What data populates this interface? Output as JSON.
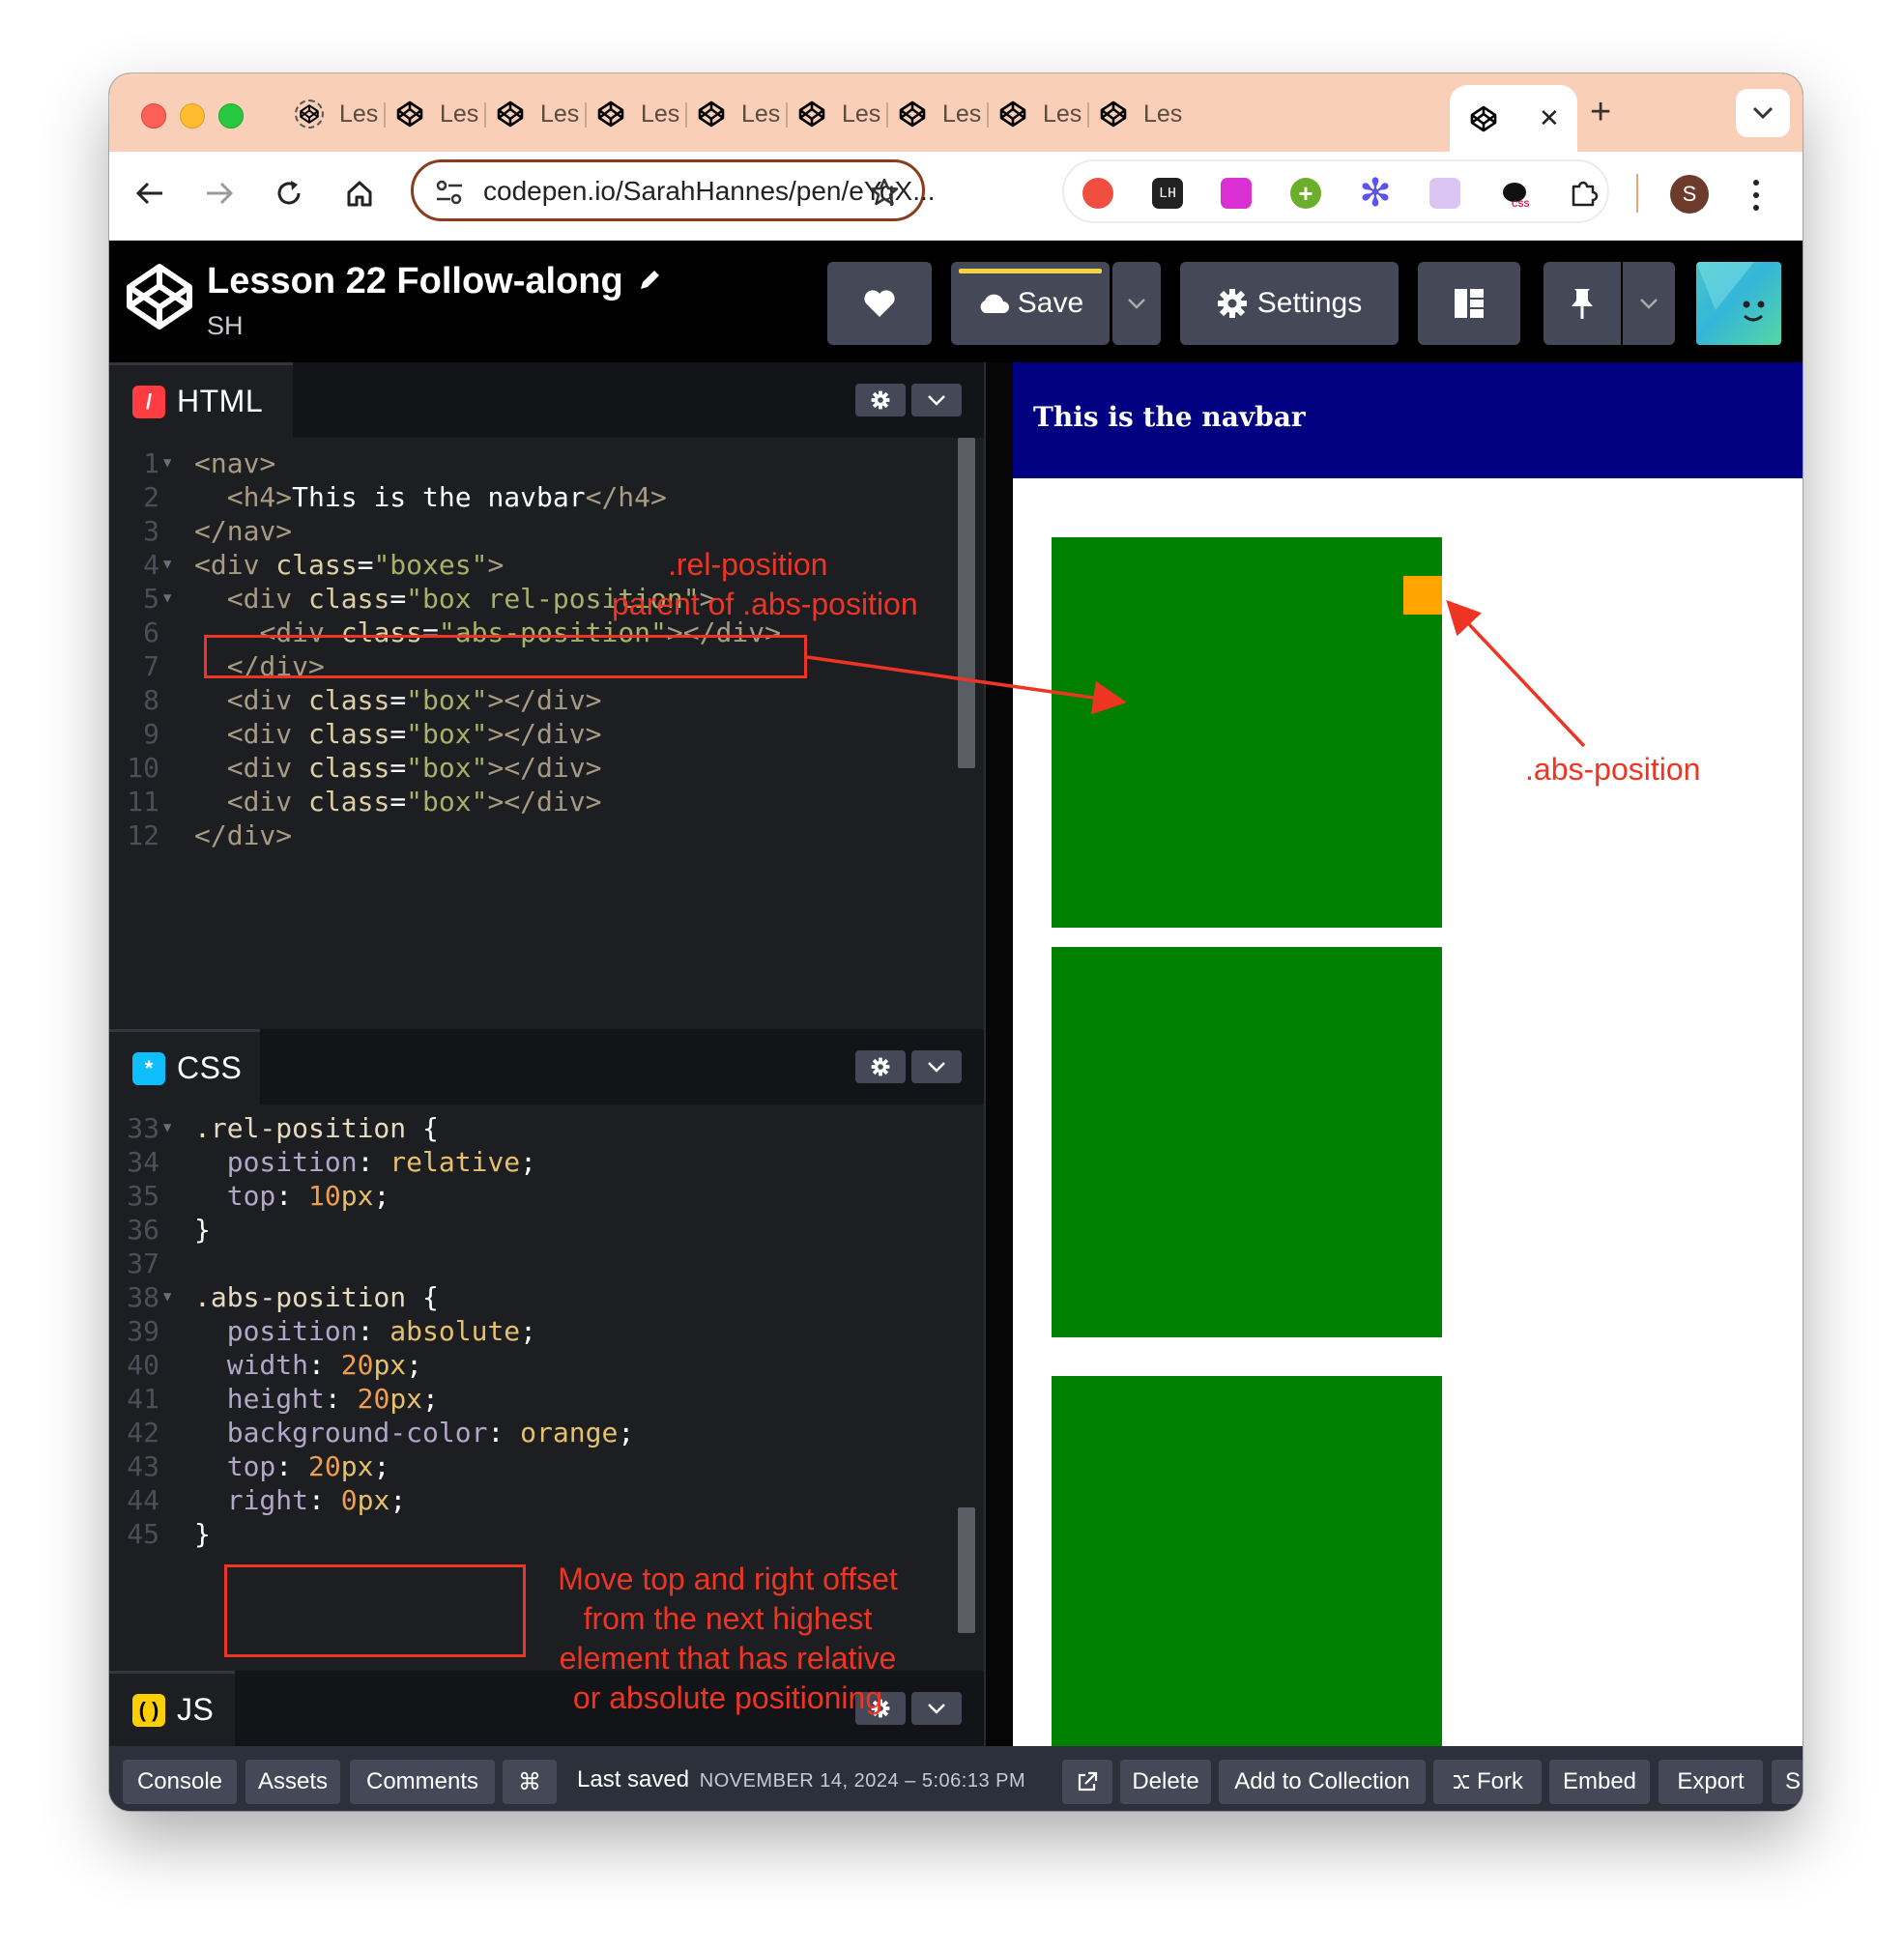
{
  "browser": {
    "tabs": [
      {
        "label": "Les"
      },
      {
        "label": "Les"
      },
      {
        "label": "Les"
      },
      {
        "label": "Les"
      },
      {
        "label": "Les"
      },
      {
        "label": "Les"
      },
      {
        "label": "Les"
      },
      {
        "label": "Les"
      },
      {
        "label": "Les"
      }
    ],
    "active_tab_close": "✕",
    "new_tab": "+",
    "url": "codepen.io/SarahHannes/pen/eYqX...",
    "profile_initial": "S"
  },
  "codepen": {
    "pen_title": "Lesson 22 Follow-along",
    "author": "SH",
    "save_label": "Save",
    "settings_label": "Settings"
  },
  "editor": {
    "html_panel_label": "HTML",
    "css_panel_label": "CSS",
    "js_panel_label": "JS",
    "html_lines": [
      {
        "n": "1",
        "code": "<nav>"
      },
      {
        "n": "2",
        "code": "  <h4>This is the navbar</h4>"
      },
      {
        "n": "3",
        "code": "</nav>"
      },
      {
        "n": "4",
        "code": "<div class=\"boxes\">"
      },
      {
        "n": "5",
        "code": "  <div class=\"box rel-position\">"
      },
      {
        "n": "6",
        "code": "    <div class=\"abs-position\"></div>"
      },
      {
        "n": "7",
        "code": "  </div>"
      },
      {
        "n": "8",
        "code": "  <div class=\"box\"></div>"
      },
      {
        "n": "9",
        "code": "  <div class=\"box\"></div>"
      },
      {
        "n": "10",
        "code": "  <div class=\"box\"></div>"
      },
      {
        "n": "11",
        "code": "  <div class=\"box\"></div>"
      },
      {
        "n": "12",
        "code": "</div>"
      }
    ],
    "css_lines": [
      {
        "n": "33",
        "code": ".rel-position {"
      },
      {
        "n": "34",
        "code": "  position: relative;"
      },
      {
        "n": "35",
        "code": "  top: 10px;"
      },
      {
        "n": "36",
        "code": "}"
      },
      {
        "n": "37",
        "code": ""
      },
      {
        "n": "38",
        "code": ".abs-position {"
      },
      {
        "n": "39",
        "code": "  position: absolute;"
      },
      {
        "n": "40",
        "code": "  width: 20px;"
      },
      {
        "n": "41",
        "code": "  height: 20px;"
      },
      {
        "n": "42",
        "code": "  background-color: orange;"
      },
      {
        "n": "43",
        "code": "  top: 20px;"
      },
      {
        "n": "44",
        "code": "  right: 0px;"
      },
      {
        "n": "45",
        "code": "}"
      }
    ]
  },
  "preview": {
    "navbar_text": "This is the navbar",
    "box_color": "#008000",
    "navbar_color": "#000080",
    "abs_color": "orange"
  },
  "annotations": {
    "rel_line1": ".rel-position",
    "rel_line2": "parent of .abs-position",
    "abs_label": ".abs-position",
    "note_lines": [
      "Move top and right offset",
      "from the next highest",
      "element that has relative",
      "or absolute positioning"
    ]
  },
  "footer": {
    "console": "Console",
    "assets": "Assets",
    "comments": "Comments",
    "shortcut": "⌘",
    "last_saved_label": "Last saved",
    "last_saved_value": "NOVEMBER 14, 2024 – 5:06:13 PM",
    "delete": "Delete",
    "add_to_collection": "Add to Collection",
    "fork": "Fork",
    "embed": "Embed",
    "export": "Export",
    "share_partial": "S"
  },
  "colors": {
    "tab_strip": "#f9cfb7",
    "annotation_red": "#ee3524",
    "save_accent": "#f2d544"
  }
}
